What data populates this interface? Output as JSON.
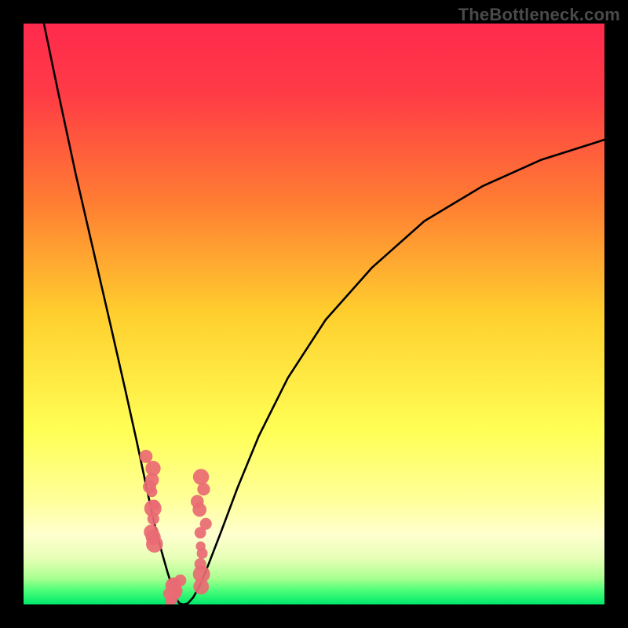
{
  "attribution": "TheBottleneck.com",
  "chart_data": {
    "type": "line",
    "title": "",
    "xlabel": "",
    "ylabel": "",
    "xlim": [
      0,
      1
    ],
    "ylim": [
      0,
      1
    ],
    "gradient_stops": [
      {
        "pos": 0.0,
        "color": "#ff2a4d"
      },
      {
        "pos": 0.12,
        "color": "#ff3b46"
      },
      {
        "pos": 0.3,
        "color": "#ff7a33"
      },
      {
        "pos": 0.5,
        "color": "#ffcf2e"
      },
      {
        "pos": 0.7,
        "color": "#ffff55"
      },
      {
        "pos": 0.82,
        "color": "#ffff9a"
      },
      {
        "pos": 0.88,
        "color": "#ffffcf"
      },
      {
        "pos": 0.92,
        "color": "#e7ffb7"
      },
      {
        "pos": 0.955,
        "color": "#a9ff90"
      },
      {
        "pos": 0.975,
        "color": "#4fff7a"
      },
      {
        "pos": 1.0,
        "color": "#00e86b"
      }
    ],
    "series": [
      {
        "name": "bottleneck-curve",
        "points": [
          [
            0.035,
            1.0
          ],
          [
            0.06,
            0.88
          ],
          [
            0.09,
            0.74
          ],
          [
            0.12,
            0.61
          ],
          [
            0.15,
            0.48
          ],
          [
            0.175,
            0.37
          ],
          [
            0.195,
            0.28
          ],
          [
            0.212,
            0.2
          ],
          [
            0.225,
            0.14
          ],
          [
            0.238,
            0.09
          ],
          [
            0.248,
            0.055
          ],
          [
            0.256,
            0.03
          ],
          [
            0.262,
            0.012
          ],
          [
            0.268,
            0.002
          ],
          [
            0.275,
            0.0
          ],
          [
            0.283,
            0.002
          ],
          [
            0.292,
            0.012
          ],
          [
            0.303,
            0.032
          ],
          [
            0.318,
            0.068
          ],
          [
            0.34,
            0.125
          ],
          [
            0.368,
            0.2
          ],
          [
            0.405,
            0.29
          ],
          [
            0.455,
            0.39
          ],
          [
            0.52,
            0.49
          ],
          [
            0.6,
            0.58
          ],
          [
            0.69,
            0.66
          ],
          [
            0.79,
            0.72
          ],
          [
            0.89,
            0.765
          ],
          [
            1.0,
            0.8
          ]
        ]
      }
    ],
    "marker_color": "#e96a73",
    "marker_clusters": [
      {
        "center_x": 0.218,
        "x_spread": 0.012,
        "y_from": 0.1,
        "y_to": 0.25,
        "count": 11
      },
      {
        "center_x": 0.26,
        "x_spread": 0.014,
        "y_from": 0.002,
        "y_to": 0.04,
        "count": 8
      },
      {
        "center_x": 0.305,
        "x_spread": 0.012,
        "y_from": 0.03,
        "y_to": 0.22,
        "count": 11
      }
    ]
  }
}
